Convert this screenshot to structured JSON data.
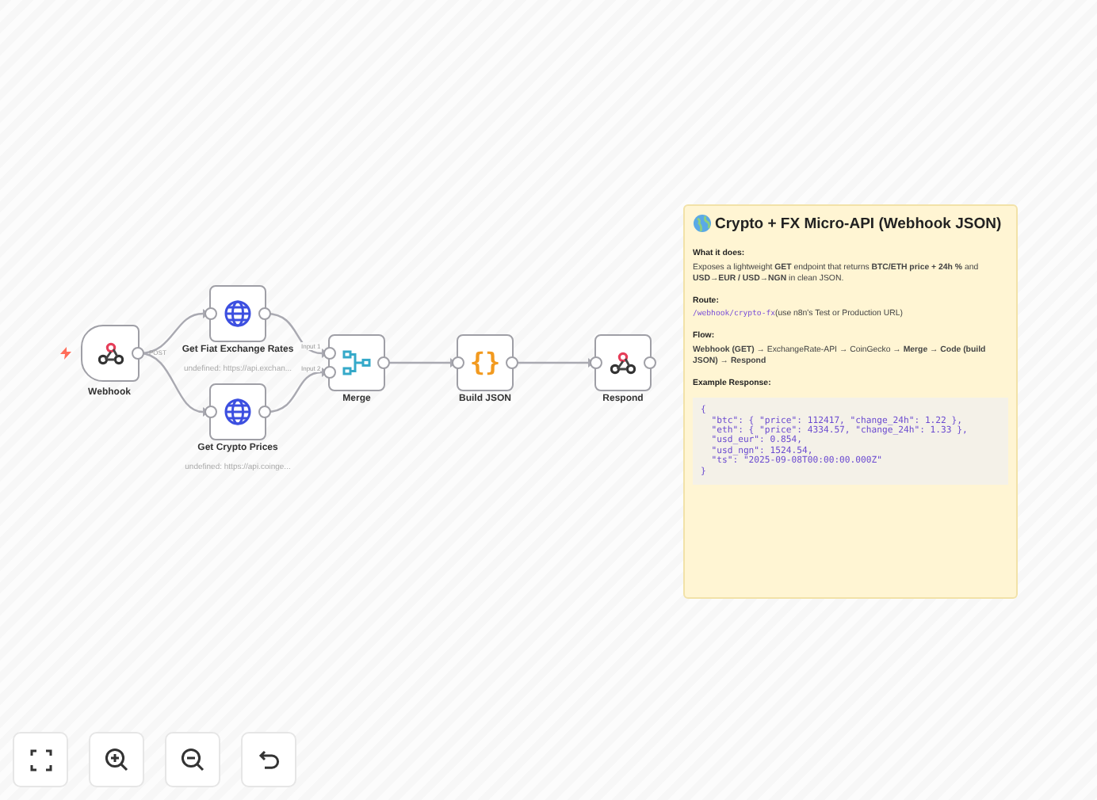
{
  "nodes": [
    {
      "kind": "trigger",
      "label": "Webhook",
      "output_label": "POST"
    },
    {
      "kind": "http",
      "label": "Get Fiat Exchange Rates",
      "subtitle": "undefined: https://api.exchan..."
    },
    {
      "kind": "http",
      "label": "Get Crypto Prices",
      "subtitle": "undefined: https://api.coinge..."
    },
    {
      "kind": "merge",
      "label": "Merge",
      "input_labels": [
        "Input 1",
        "Input 2"
      ]
    },
    {
      "kind": "code",
      "label": "Build JSON",
      "glyph": "{}"
    },
    {
      "kind": "respond",
      "label": "Respond"
    }
  ],
  "sticky_note": {
    "title": "Crypto + FX Micro-API (Webhook JSON)",
    "sections": [
      {
        "kind": "text",
        "heading": "What it does:",
        "body": "Exposes a lightweight **GET** endpoint that returns **BTC/ETH price + 24h %** and **USD→EUR / USD→NGN** in clean JSON."
      },
      {
        "kind": "route",
        "heading": "Route:",
        "code": "/webhook/crypto-fx",
        "body": "(use n8n's Test or Production URL)"
      },
      {
        "kind": "text",
        "heading": "Flow:",
        "body": "**Webhook (GET)** → ExchangeRate-API → CoinGecko → **Merge** → **Code (build JSON)** → **Respond**"
      },
      {
        "kind": "codeblock",
        "heading": "Example Response:",
        "lines": [
          "{",
          "  \"btc\": { \"price\": 112417, \"change_24h\": 1.22 },",
          "  \"eth\": { \"price\": 4334.57, \"change_24h\": 1.33 },",
          "  \"usd_eur\": 0.854,",
          "  \"usd_ngn\": 1524.54,",
          "  \"ts\": \"2025-09-08T00:00:00.000Z\"",
          "}"
        ]
      }
    ]
  }
}
